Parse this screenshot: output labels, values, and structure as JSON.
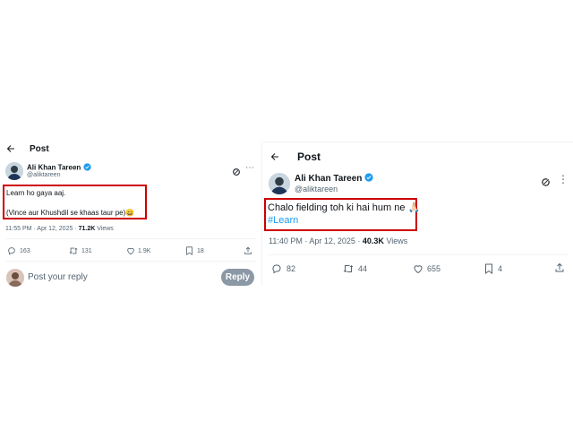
{
  "left": {
    "header_title": "Post",
    "author": {
      "name": "Ali Khan Tareen",
      "handle": "@aliktareen"
    },
    "tweet": {
      "line1": "Learn ho gaya aaj.",
      "line2": "(Vince aur Khushdil se khaas taur pe)",
      "emoji": "😄"
    },
    "meta": {
      "time_date": "11:55 PM · Apr 12, 2025 · ",
      "views_count": "71.2K",
      "views_label": " Views"
    },
    "actions": {
      "replies": "163",
      "reposts": "131",
      "likes": "1.9K",
      "bookmarks": "18"
    },
    "reply_box": {
      "placeholder": "Post your reply",
      "button_label": "Reply"
    }
  },
  "right": {
    "header_title": "Post",
    "author": {
      "name": "Ali Khan Tareen",
      "handle": "@aliktareen"
    },
    "tweet": {
      "text": "Chalo fielding toh ki hai hum ne ",
      "emoji": "🙏🏻",
      "hashtag": "#Learn"
    },
    "meta": {
      "time_date": "11:40 PM · Apr 12, 2025 · ",
      "views_count": "40.3K",
      "views_label": " Views"
    },
    "actions": {
      "replies": "82",
      "reposts": "44",
      "likes": "655",
      "bookmarks": "4"
    }
  },
  "colors": {
    "highlight_border": "#cc0000",
    "verified_badge": "#1d9bf0",
    "link": "#1d9bf0",
    "muted_text": "#536471",
    "reply_button": "#8b98a5"
  }
}
